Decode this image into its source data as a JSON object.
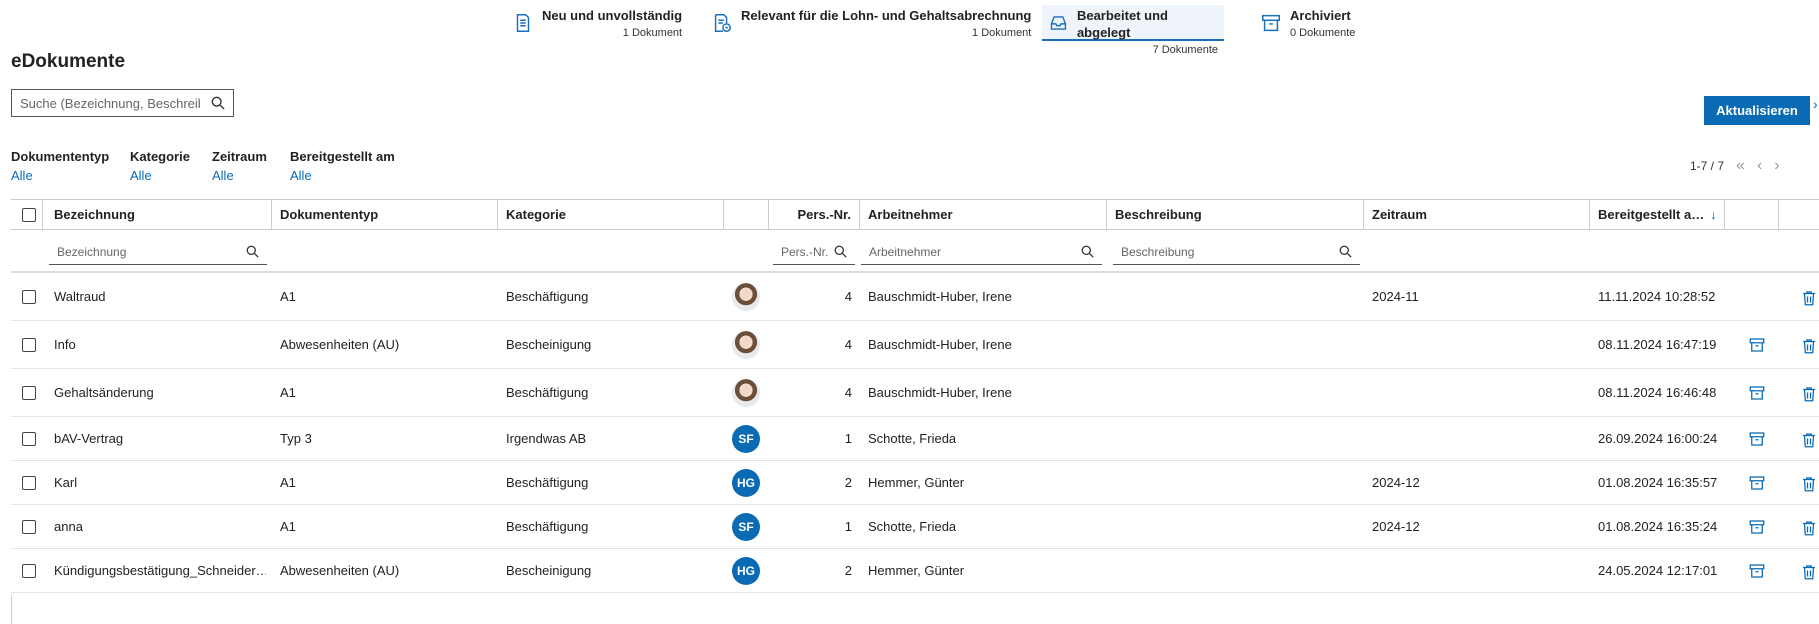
{
  "tabs": [
    {
      "title": "Neu und unvollständig",
      "count": "1 Dokument",
      "icon": "document-icon"
    },
    {
      "title": "Relevant für die Lohn- und Gehaltsabrechnung",
      "count": "1 Dokument",
      "icon": "payroll-document-icon"
    },
    {
      "title": "Bearbeitet und abgelegt",
      "count": "7 Dokumente",
      "icon": "inbox-icon",
      "active": true
    },
    {
      "title": "Archiviert",
      "count": "0 Dokumente",
      "icon": "archive-icon"
    }
  ],
  "page_title": "eDokumente",
  "search": {
    "placeholder": "Suche (Bezeichnung, Beschreib…"
  },
  "refresh_label": "Aktualisieren",
  "filters": [
    {
      "label": "Dokumententyp",
      "value": "Alle"
    },
    {
      "label": "Kategorie",
      "value": "Alle"
    },
    {
      "label": "Zeitraum",
      "value": "Alle"
    },
    {
      "label": "Bereitgestellt am",
      "value": "Alle"
    }
  ],
  "pager": {
    "range": "1-7 / 7"
  },
  "columns": {
    "bezeichnung": "Bezeichnung",
    "dokumententyp": "Dokumententyp",
    "kategorie": "Kategorie",
    "persnr": "Pers.-Nr.",
    "arbeitnehmer": "Arbeitnehmer",
    "beschreibung": "Beschreibung",
    "zeitraum": "Zeitraum",
    "bereitgestellt": "Bereitgestellt a…"
  },
  "column_filters": {
    "bezeichnung": "Bezeichnung",
    "persnr": "Pers.-Nr.",
    "arbeitnehmer": "Arbeitnehmer",
    "beschreibung": "Beschreibung"
  },
  "rows": [
    {
      "bezeichnung": "Waltraud",
      "typ": "A1",
      "kategorie": "Beschäftigung",
      "avatar": "photo",
      "initials": "",
      "persnr": "4",
      "arbeitnehmer": "Bauschmidt-Huber, Irene",
      "beschreibung": "",
      "zeitraum": "2024-11",
      "bereitgestellt": "11.11.2024 10:28:52",
      "archive": false
    },
    {
      "bezeichnung": "Info",
      "typ": "Abwesenheiten (AU)",
      "kategorie": "Bescheinigung",
      "avatar": "photo",
      "initials": "",
      "persnr": "4",
      "arbeitnehmer": "Bauschmidt-Huber, Irene",
      "beschreibung": "",
      "zeitraum": "",
      "bereitgestellt": "08.11.2024 16:47:19",
      "archive": true
    },
    {
      "bezeichnung": "Gehaltsänderung",
      "typ": "A1",
      "kategorie": "Beschäftigung",
      "avatar": "photo",
      "initials": "",
      "persnr": "4",
      "arbeitnehmer": "Bauschmidt-Huber, Irene",
      "beschreibung": "",
      "zeitraum": "",
      "bereitgestellt": "08.11.2024 16:46:48",
      "archive": true
    },
    {
      "bezeichnung": "bAV-Vertrag",
      "typ": "Typ 3",
      "kategorie": "Irgendwas AB",
      "avatar": "initials",
      "initials": "SF",
      "persnr": "1",
      "arbeitnehmer": "Schotte, Frieda",
      "beschreibung": "",
      "zeitraum": "",
      "bereitgestellt": "26.09.2024 16:00:24",
      "archive": true
    },
    {
      "bezeichnung": "Karl",
      "typ": "A1",
      "kategorie": "Beschäftigung",
      "avatar": "initials",
      "initials": "HG",
      "persnr": "2",
      "arbeitnehmer": "Hemmer, Günter",
      "beschreibung": "",
      "zeitraum": "2024-12",
      "bereitgestellt": "01.08.2024 16:35:57",
      "archive": true
    },
    {
      "bezeichnung": "anna",
      "typ": "A1",
      "kategorie": "Beschäftigung",
      "avatar": "initials",
      "initials": "SF",
      "persnr": "1",
      "arbeitnehmer": "Schotte, Frieda",
      "beschreibung": "",
      "zeitraum": "2024-12",
      "bereitgestellt": "01.08.2024 16:35:24",
      "archive": true
    },
    {
      "bezeichnung": "Kündigungsbestätigung_Schneider…",
      "typ": "Abwesenheiten (AU)",
      "kategorie": "Bescheinigung",
      "avatar": "initials",
      "initials": "HG",
      "persnr": "2",
      "arbeitnehmer": "Hemmer, Günter",
      "beschreibung": "",
      "zeitraum": "",
      "bereitgestellt": "24.05.2024 12:17:01",
      "archive": true
    }
  ],
  "colors": {
    "accent": "#0a6bb4"
  }
}
